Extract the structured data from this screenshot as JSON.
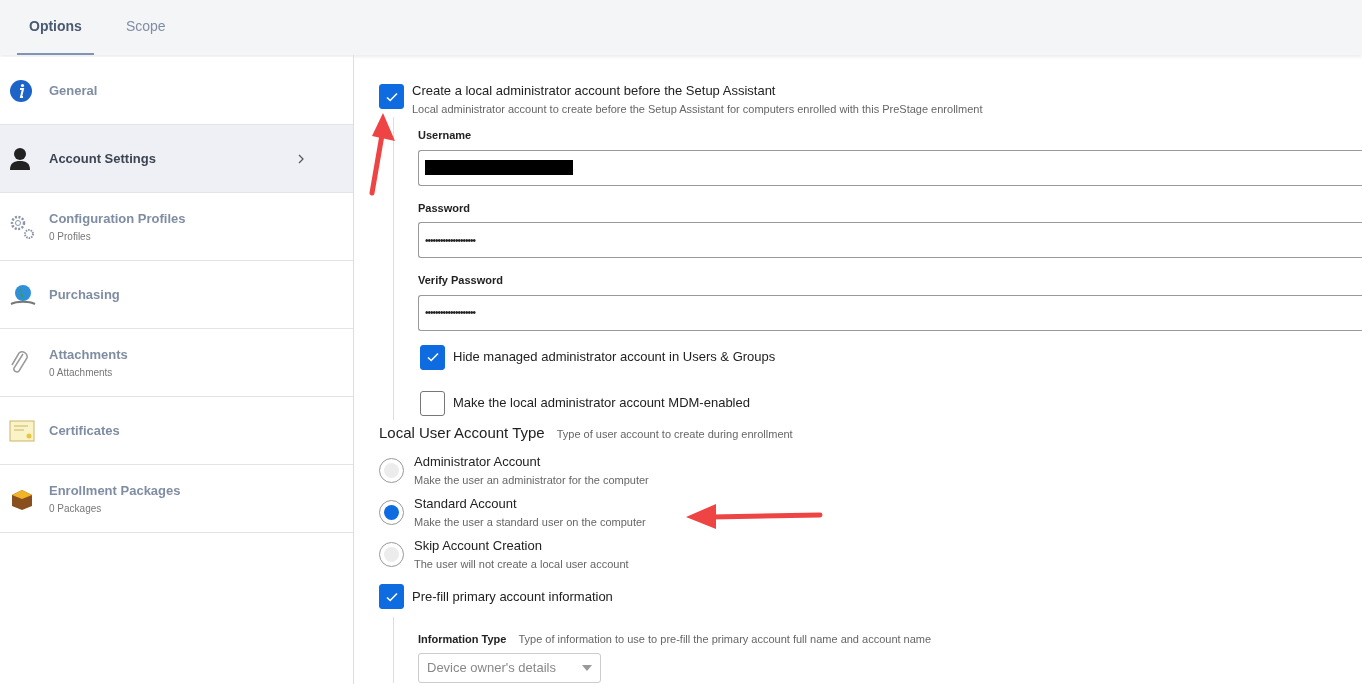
{
  "tabs": [
    {
      "label": "Options",
      "selected": true
    },
    {
      "label": "Scope",
      "selected": false
    }
  ],
  "sidebar": {
    "items": [
      {
        "label": "General",
        "selected": false
      },
      {
        "label": "Account Settings",
        "selected": true
      },
      {
        "label": "Configuration Profiles",
        "count": "0 Profiles",
        "selected": false
      },
      {
        "label": "Purchasing",
        "selected": false
      },
      {
        "label": "Attachments",
        "count": "0 Attachments",
        "selected": false
      },
      {
        "label": "Certificates",
        "selected": false
      },
      {
        "label": "Enrollment Packages",
        "count": "0 Packages",
        "selected": false
      }
    ]
  },
  "admin_account": {
    "label": "Create a local administrator account before the Setup Assistant",
    "description": "Local administrator account to create before the Setup Assistant for computers enrolled with this PreStage enrollment",
    "checked": true,
    "fields": [
      {
        "label": "Username",
        "redacted": true
      },
      {
        "label": "Password",
        "value": "••••••••••••••••••••"
      },
      {
        "label": "Verify Password",
        "value": "••••••••••••••••••••"
      }
    ],
    "options": [
      {
        "label": "Hide managed administrator account in Users & Groups",
        "checked": true
      },
      {
        "label": "Make the local administrator account MDM-enabled",
        "checked": false
      }
    ]
  },
  "account_type": {
    "title": "Local User Account Type",
    "description": "Type of user account to create during enrollment",
    "options": [
      {
        "label": "Administrator Account",
        "description": "Make the user an administrator for the computer",
        "selected": false
      },
      {
        "label": "Standard Account",
        "description": "Make the user a standard user on the computer",
        "selected": true
      },
      {
        "label": "Skip Account Creation",
        "description": "The user will not create a local user account",
        "selected": false
      }
    ]
  },
  "prefill": {
    "label": "Pre-fill primary account information",
    "checked": true,
    "info_label": "Information Type",
    "info_description": "Type of information to use to pre-fill the primary account full name and account name",
    "select_value": "Device owner's details"
  }
}
